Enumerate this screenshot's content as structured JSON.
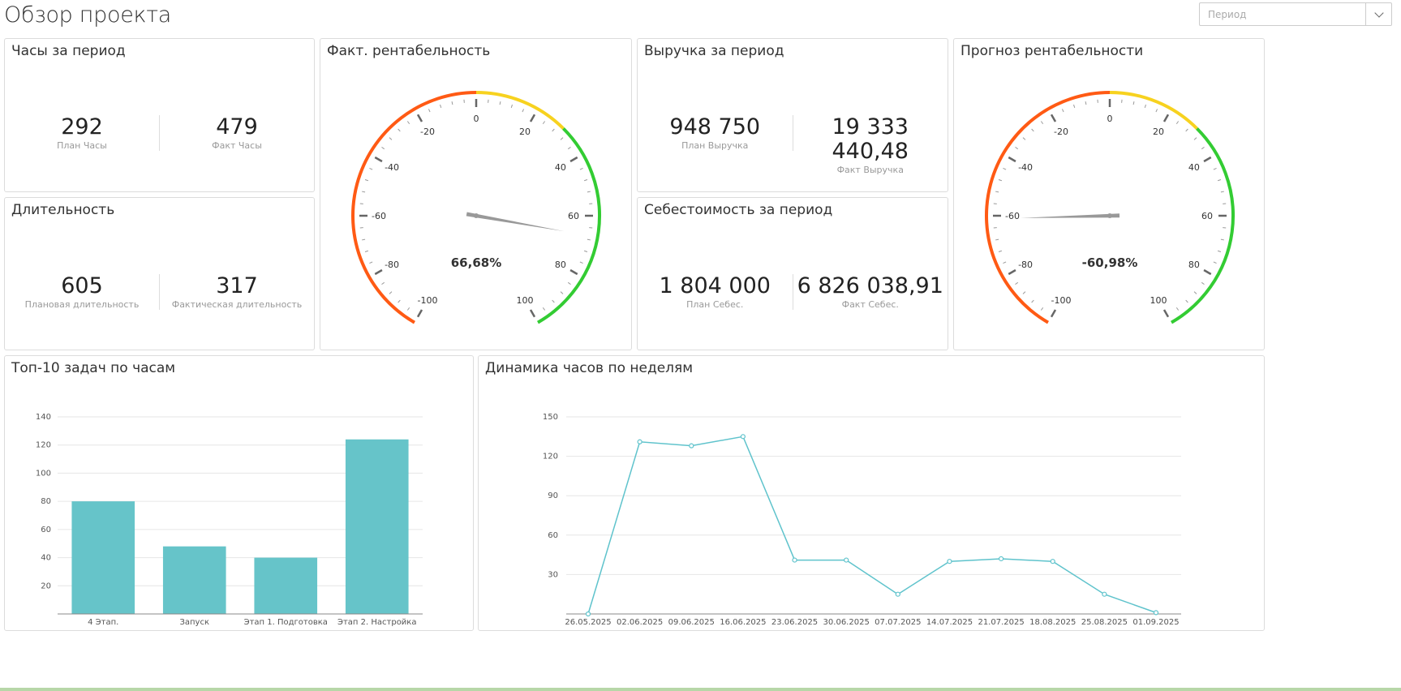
{
  "page": {
    "title": "Обзор проекта"
  },
  "filter": {
    "placeholder": "Период"
  },
  "panels": {
    "hours": {
      "title": "Часы за период",
      "plan_value": "292",
      "plan_label": "План Часы",
      "fact_value": "479",
      "fact_label": "Факт Часы"
    },
    "duration": {
      "title": "Длительность",
      "plan_value": "605",
      "plan_label": "Плановая длительность",
      "fact_value": "317",
      "fact_label": "Фактическая длительность"
    },
    "revenue": {
      "title": "Выручка за период",
      "plan_value": "948 750",
      "plan_label": "План Выручка",
      "fact_value": "19 333 440,48",
      "fact_label": "Факт Выручка"
    },
    "cost": {
      "title": "Себестоимость за период",
      "plan_value": "1 804 000",
      "plan_label": "План Себес.",
      "fact_value": "6 826 038,91",
      "fact_label": "Факт Себес."
    },
    "fact_profit": {
      "title": "Факт. рентабельность",
      "value": 66.68,
      "value_text": "66,68%"
    },
    "forecast_profit": {
      "title": "Прогноз рентабельности",
      "value": -60.98,
      "value_text": "-60,98%"
    },
    "top_tasks": {
      "title": "Топ-10 задач по часам"
    },
    "weekly": {
      "title": "Динамика часов по неделям"
    }
  },
  "gauge": {
    "min": -100,
    "max": 100,
    "labels": [
      "-100",
      "-80",
      "-60",
      "-40",
      "-20",
      "0",
      "20",
      "40",
      "60",
      "80",
      "100"
    ],
    "bands": [
      {
        "from": -100,
        "to": 0,
        "color": "#ff5a14"
      },
      {
        "from": 0,
        "to": 30,
        "color": "#f7d21f"
      },
      {
        "from": 30,
        "to": 100,
        "color": "#33cc33"
      }
    ],
    "needle_color": "#999999"
  },
  "chart_data": [
    {
      "type": "bar",
      "categories": [
        "4 Этап.",
        "Запуск",
        "Этап 1. Подготовка",
        "Этап 2. Настройка"
      ],
      "values": [
        80,
        48,
        40,
        124
      ],
      "ylim": [
        0,
        140
      ],
      "yticks": [
        "20",
        "40",
        "60",
        "80",
        "100",
        "120",
        "140"
      ],
      "color": "#66c4c9",
      "grid": true
    },
    {
      "type": "line",
      "x": [
        "26.05.2025",
        "02.06.2025",
        "09.06.2025",
        "16.06.2025",
        "23.06.2025",
        "30.06.2025",
        "07.07.2025",
        "14.07.2025",
        "21.07.2025",
        "18.08.2025",
        "25.08.2025",
        "01.09.2025"
      ],
      "values": [
        0,
        131,
        128,
        135,
        41,
        41,
        15,
        40,
        42,
        40,
        15,
        1
      ],
      "ylim": [
        0,
        150
      ],
      "yticks": [
        "30",
        "60",
        "90",
        "120",
        "150"
      ],
      "color": "#5fc3cc",
      "grid": true
    }
  ]
}
